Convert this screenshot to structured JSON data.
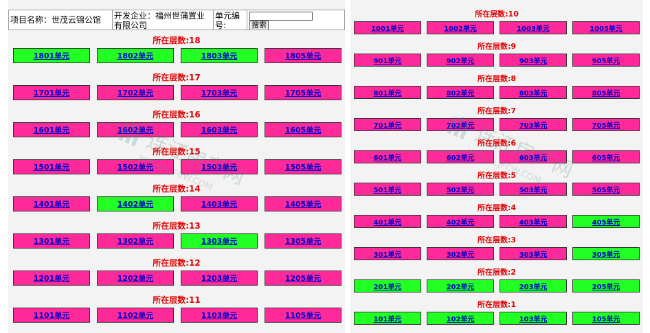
{
  "header": {
    "project_label": "项目名称：世茂云锦公馆",
    "developer_label": "开发企业：福州世蒲置业有限公司",
    "unit_no_label": "单元编号:",
    "search_button": "搜索",
    "search_value": ""
  },
  "floor_prefix": "所在层数:",
  "left_floors": [
    {
      "label": "所在层数:18",
      "units": [
        {
          "name": "1801单元",
          "status": "green"
        },
        {
          "name": "1802单元",
          "status": "green"
        },
        {
          "name": "1803单元",
          "status": "green"
        },
        {
          "name": "1805单元",
          "status": "pink"
        }
      ]
    },
    {
      "label": "所在层数:17",
      "units": [
        {
          "name": "1701单元",
          "status": "pink"
        },
        {
          "name": "1702单元",
          "status": "pink"
        },
        {
          "name": "1703单元",
          "status": "pink"
        },
        {
          "name": "1705单元",
          "status": "pink"
        }
      ]
    },
    {
      "label": "所在层数:16",
      "units": [
        {
          "name": "1601单元",
          "status": "pink"
        },
        {
          "name": "1602单元",
          "status": "pink"
        },
        {
          "name": "1603单元",
          "status": "pink"
        },
        {
          "name": "1605单元",
          "status": "pink"
        }
      ]
    },
    {
      "label": "所在层数:15",
      "units": [
        {
          "name": "1501单元",
          "status": "pink"
        },
        {
          "name": "1502单元",
          "status": "pink"
        },
        {
          "name": "1503单元",
          "status": "pink"
        },
        {
          "name": "1505单元",
          "status": "pink"
        }
      ]
    },
    {
      "label": "所在层数:14",
      "units": [
        {
          "name": "1401单元",
          "status": "pink"
        },
        {
          "name": "1402单元",
          "status": "green"
        },
        {
          "name": "1403单元",
          "status": "pink"
        },
        {
          "name": "1405单元",
          "status": "pink"
        }
      ]
    },
    {
      "label": "所在层数:13",
      "units": [
        {
          "name": "1301单元",
          "status": "pink"
        },
        {
          "name": "1302单元",
          "status": "pink"
        },
        {
          "name": "1303单元",
          "status": "green"
        },
        {
          "name": "1305单元",
          "status": "pink"
        }
      ]
    },
    {
      "label": "所在层数:12",
      "units": [
        {
          "name": "1201单元",
          "status": "pink"
        },
        {
          "name": "1202单元",
          "status": "pink"
        },
        {
          "name": "1203单元",
          "status": "pink"
        },
        {
          "name": "1205单元",
          "status": "pink"
        }
      ]
    },
    {
      "label": "所在层数:11",
      "units": [
        {
          "name": "1101单元",
          "status": "pink"
        },
        {
          "name": "1102单元",
          "status": "pink"
        },
        {
          "name": "1103单元",
          "status": "pink"
        },
        {
          "name": "1105单元",
          "status": "pink"
        }
      ]
    }
  ],
  "right_floors": [
    {
      "label": "所在层数:10",
      "units": [
        {
          "name": "1001单元",
          "status": "pink"
        },
        {
          "name": "1002单元",
          "status": "pink"
        },
        {
          "name": "1003单元",
          "status": "pink"
        },
        {
          "name": "1005单元",
          "status": "pink"
        }
      ]
    },
    {
      "label": "所在层数:9",
      "units": [
        {
          "name": "901单元",
          "status": "pink"
        },
        {
          "name": "902单元",
          "status": "pink"
        },
        {
          "name": "903单元",
          "status": "pink"
        },
        {
          "name": "905单元",
          "status": "pink"
        }
      ]
    },
    {
      "label": "所在层数:8",
      "units": [
        {
          "name": "801单元",
          "status": "pink"
        },
        {
          "name": "802单元",
          "status": "pink"
        },
        {
          "name": "803单元",
          "status": "pink"
        },
        {
          "name": "805单元",
          "status": "pink"
        }
      ]
    },
    {
      "label": "所在层数:7",
      "units": [
        {
          "name": "701单元",
          "status": "pink"
        },
        {
          "name": "702单元",
          "status": "pink"
        },
        {
          "name": "703单元",
          "status": "pink"
        },
        {
          "name": "705单元",
          "status": "pink"
        }
      ]
    },
    {
      "label": "所在层数:6",
      "units": [
        {
          "name": "601单元",
          "status": "pink"
        },
        {
          "name": "602单元",
          "status": "pink"
        },
        {
          "name": "603单元",
          "status": "pink"
        },
        {
          "name": "605单元",
          "status": "pink"
        }
      ]
    },
    {
      "label": "所在层数:5",
      "units": [
        {
          "name": "501单元",
          "status": "pink"
        },
        {
          "name": "502单元",
          "status": "pink"
        },
        {
          "name": "503单元",
          "status": "pink"
        },
        {
          "name": "505单元",
          "status": "pink"
        }
      ]
    },
    {
      "label": "所在层数:4",
      "units": [
        {
          "name": "401单元",
          "status": "pink"
        },
        {
          "name": "402单元",
          "status": "pink"
        },
        {
          "name": "403单元",
          "status": "pink"
        },
        {
          "name": "405单元",
          "status": "green"
        }
      ]
    },
    {
      "label": "所在层数:3",
      "units": [
        {
          "name": "301单元",
          "status": "pink"
        },
        {
          "name": "302单元",
          "status": "pink"
        },
        {
          "name": "303单元",
          "status": "pink"
        },
        {
          "name": "305单元",
          "status": "green"
        }
      ]
    },
    {
      "label": "所在层数:2",
      "units": [
        {
          "name": "201单元",
          "status": "green"
        },
        {
          "name": "202单元",
          "status": "green"
        },
        {
          "name": "203单元",
          "status": "green"
        },
        {
          "name": "205单元",
          "status": "green"
        }
      ]
    },
    {
      "label": "所在层数:1",
      "units": [
        {
          "name": "101单元",
          "status": "green"
        },
        {
          "name": "102单元",
          "status": "green"
        },
        {
          "name": "103单元",
          "status": "green"
        },
        {
          "name": "105单元",
          "status": "green"
        }
      ]
    }
  ],
  "watermark": {
    "text": "连江房产网",
    "url_text": "WWW.LJFCW.COM"
  },
  "colors": {
    "unsold": "#ff2a9a",
    "available": "#22ff22",
    "floor_label": "#e00000",
    "link": "#0000cc"
  }
}
